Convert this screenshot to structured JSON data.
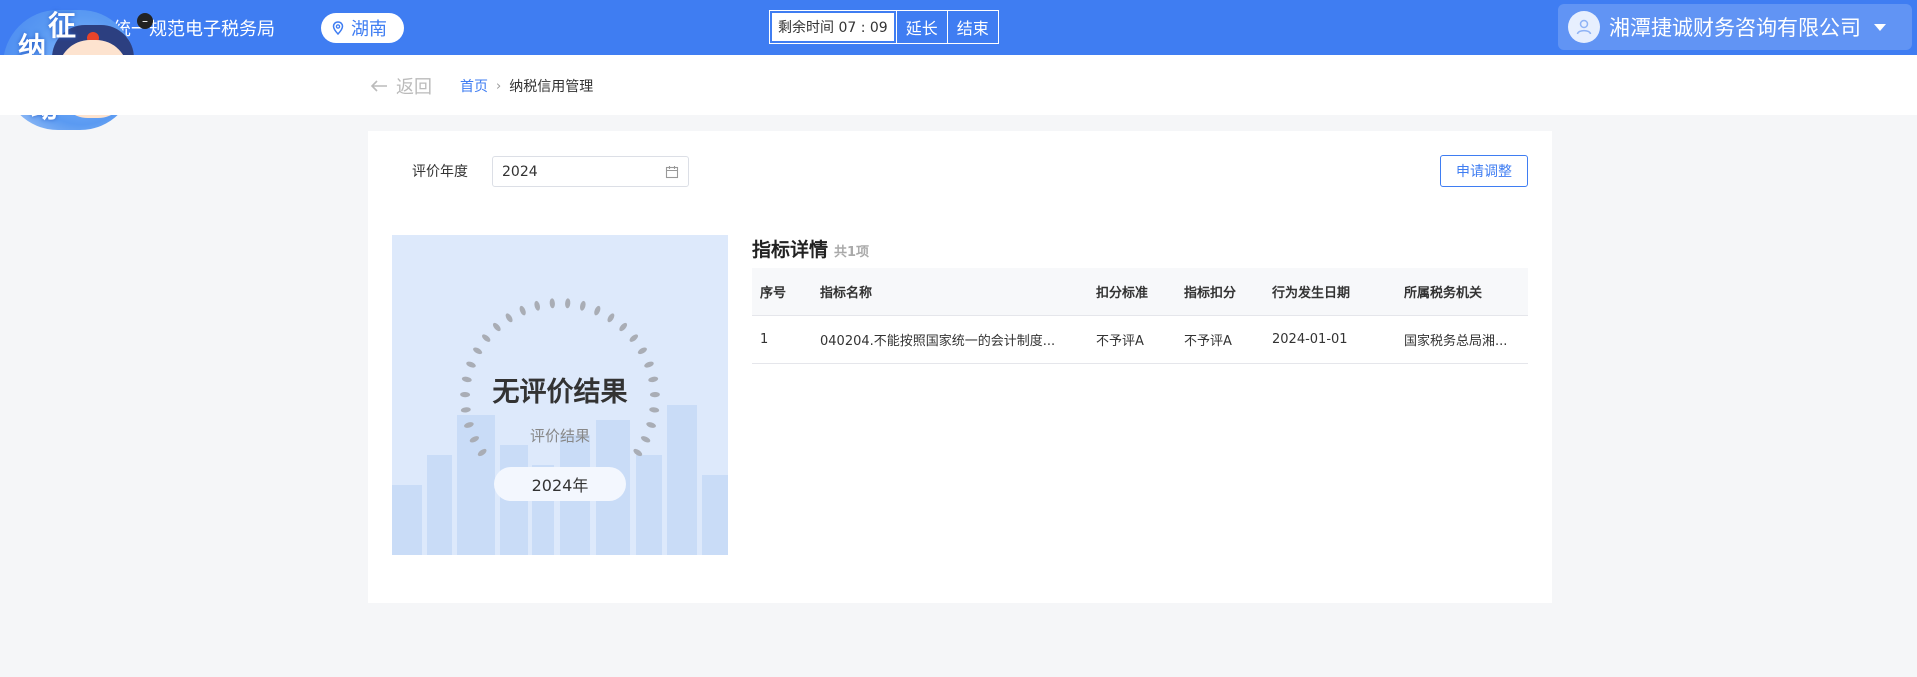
{
  "header": {
    "site_title": "国统一规范电子税务局",
    "region": "湖南",
    "timer": "剩余时间 07 : 09",
    "extend_label": "延长",
    "end_label": "结束",
    "company": "湘潭捷诚财务咨询有限公司"
  },
  "mascot": {
    "chars": [
      "征",
      "纳",
      "互",
      "动"
    ]
  },
  "nav": {
    "back_label": "返回",
    "breadcrumb": [
      "首页",
      "纳税信用管理"
    ]
  },
  "filter": {
    "year_label": "评价年度",
    "year_value": "2024",
    "apply_label": "申请调整"
  },
  "result": {
    "title": "无评价结果",
    "subtitle": "评价结果",
    "year_pill": "2024年"
  },
  "detail": {
    "title": "指标详情",
    "count": "共1项",
    "columns": [
      "序号",
      "指标名称",
      "扣分标准",
      "指标扣分",
      "行为发生日期",
      "所属税务机关"
    ],
    "rows": [
      [
        "1",
        "040204.不能按照国家统一的会计制度...",
        "不予评A",
        "不予评A",
        "2024-01-01",
        "国家税务总局湘..."
      ]
    ]
  },
  "colors": {
    "primary": "#3f7df2",
    "background": "#f5f6f8",
    "result_panel": "#dde9fb"
  }
}
